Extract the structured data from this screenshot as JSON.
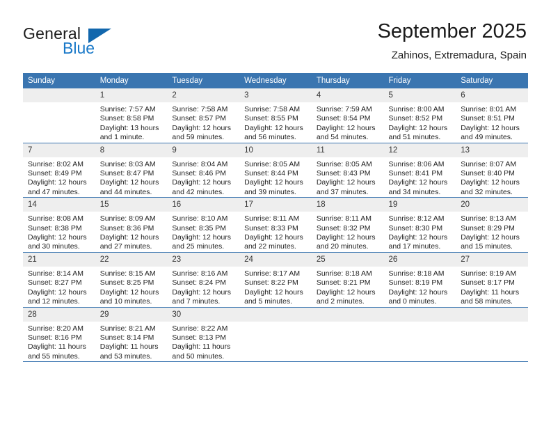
{
  "brand": {
    "name_part1": "General",
    "name_part2": "Blue"
  },
  "header": {
    "title": "September 2025",
    "subtitle": "Zahinos, Extremadura, Spain"
  },
  "colors": {
    "header_blue": "#3A75B0",
    "logo_blue": "#1878C8",
    "daynum_band": "#EEEEEE"
  },
  "weekday_headers": [
    "Sunday",
    "Monday",
    "Tuesday",
    "Wednesday",
    "Thursday",
    "Friday",
    "Saturday"
  ],
  "labels": {
    "sunrise_prefix": "Sunrise:",
    "sunset_prefix": "Sunset:",
    "daylight_prefix": "Daylight:"
  },
  "weeks": [
    [
      {
        "day": "",
        "sunrise": "",
        "sunset": "",
        "daylight1": "",
        "daylight2": ""
      },
      {
        "day": "1",
        "sunrise": "Sunrise: 7:57 AM",
        "sunset": "Sunset: 8:58 PM",
        "daylight1": "Daylight: 13 hours",
        "daylight2": "and 1 minute."
      },
      {
        "day": "2",
        "sunrise": "Sunrise: 7:58 AM",
        "sunset": "Sunset: 8:57 PM",
        "daylight1": "Daylight: 12 hours",
        "daylight2": "and 59 minutes."
      },
      {
        "day": "3",
        "sunrise": "Sunrise: 7:58 AM",
        "sunset": "Sunset: 8:55 PM",
        "daylight1": "Daylight: 12 hours",
        "daylight2": "and 56 minutes."
      },
      {
        "day": "4",
        "sunrise": "Sunrise: 7:59 AM",
        "sunset": "Sunset: 8:54 PM",
        "daylight1": "Daylight: 12 hours",
        "daylight2": "and 54 minutes."
      },
      {
        "day": "5",
        "sunrise": "Sunrise: 8:00 AM",
        "sunset": "Sunset: 8:52 PM",
        "daylight1": "Daylight: 12 hours",
        "daylight2": "and 51 minutes."
      },
      {
        "day": "6",
        "sunrise": "Sunrise: 8:01 AM",
        "sunset": "Sunset: 8:51 PM",
        "daylight1": "Daylight: 12 hours",
        "daylight2": "and 49 minutes."
      }
    ],
    [
      {
        "day": "7",
        "sunrise": "Sunrise: 8:02 AM",
        "sunset": "Sunset: 8:49 PM",
        "daylight1": "Daylight: 12 hours",
        "daylight2": "and 47 minutes."
      },
      {
        "day": "8",
        "sunrise": "Sunrise: 8:03 AM",
        "sunset": "Sunset: 8:47 PM",
        "daylight1": "Daylight: 12 hours",
        "daylight2": "and 44 minutes."
      },
      {
        "day": "9",
        "sunrise": "Sunrise: 8:04 AM",
        "sunset": "Sunset: 8:46 PM",
        "daylight1": "Daylight: 12 hours",
        "daylight2": "and 42 minutes."
      },
      {
        "day": "10",
        "sunrise": "Sunrise: 8:05 AM",
        "sunset": "Sunset: 8:44 PM",
        "daylight1": "Daylight: 12 hours",
        "daylight2": "and 39 minutes."
      },
      {
        "day": "11",
        "sunrise": "Sunrise: 8:05 AM",
        "sunset": "Sunset: 8:43 PM",
        "daylight1": "Daylight: 12 hours",
        "daylight2": "and 37 minutes."
      },
      {
        "day": "12",
        "sunrise": "Sunrise: 8:06 AM",
        "sunset": "Sunset: 8:41 PM",
        "daylight1": "Daylight: 12 hours",
        "daylight2": "and 34 minutes."
      },
      {
        "day": "13",
        "sunrise": "Sunrise: 8:07 AM",
        "sunset": "Sunset: 8:40 PM",
        "daylight1": "Daylight: 12 hours",
        "daylight2": "and 32 minutes."
      }
    ],
    [
      {
        "day": "14",
        "sunrise": "Sunrise: 8:08 AM",
        "sunset": "Sunset: 8:38 PM",
        "daylight1": "Daylight: 12 hours",
        "daylight2": "and 30 minutes."
      },
      {
        "day": "15",
        "sunrise": "Sunrise: 8:09 AM",
        "sunset": "Sunset: 8:36 PM",
        "daylight1": "Daylight: 12 hours",
        "daylight2": "and 27 minutes."
      },
      {
        "day": "16",
        "sunrise": "Sunrise: 8:10 AM",
        "sunset": "Sunset: 8:35 PM",
        "daylight1": "Daylight: 12 hours",
        "daylight2": "and 25 minutes."
      },
      {
        "day": "17",
        "sunrise": "Sunrise: 8:11 AM",
        "sunset": "Sunset: 8:33 PM",
        "daylight1": "Daylight: 12 hours",
        "daylight2": "and 22 minutes."
      },
      {
        "day": "18",
        "sunrise": "Sunrise: 8:11 AM",
        "sunset": "Sunset: 8:32 PM",
        "daylight1": "Daylight: 12 hours",
        "daylight2": "and 20 minutes."
      },
      {
        "day": "19",
        "sunrise": "Sunrise: 8:12 AM",
        "sunset": "Sunset: 8:30 PM",
        "daylight1": "Daylight: 12 hours",
        "daylight2": "and 17 minutes."
      },
      {
        "day": "20",
        "sunrise": "Sunrise: 8:13 AM",
        "sunset": "Sunset: 8:29 PM",
        "daylight1": "Daylight: 12 hours",
        "daylight2": "and 15 minutes."
      }
    ],
    [
      {
        "day": "21",
        "sunrise": "Sunrise: 8:14 AM",
        "sunset": "Sunset: 8:27 PM",
        "daylight1": "Daylight: 12 hours",
        "daylight2": "and 12 minutes."
      },
      {
        "day": "22",
        "sunrise": "Sunrise: 8:15 AM",
        "sunset": "Sunset: 8:25 PM",
        "daylight1": "Daylight: 12 hours",
        "daylight2": "and 10 minutes."
      },
      {
        "day": "23",
        "sunrise": "Sunrise: 8:16 AM",
        "sunset": "Sunset: 8:24 PM",
        "daylight1": "Daylight: 12 hours",
        "daylight2": "and 7 minutes."
      },
      {
        "day": "24",
        "sunrise": "Sunrise: 8:17 AM",
        "sunset": "Sunset: 8:22 PM",
        "daylight1": "Daylight: 12 hours",
        "daylight2": "and 5 minutes."
      },
      {
        "day": "25",
        "sunrise": "Sunrise: 8:18 AM",
        "sunset": "Sunset: 8:21 PM",
        "daylight1": "Daylight: 12 hours",
        "daylight2": "and 2 minutes."
      },
      {
        "day": "26",
        "sunrise": "Sunrise: 8:18 AM",
        "sunset": "Sunset: 8:19 PM",
        "daylight1": "Daylight: 12 hours",
        "daylight2": "and 0 minutes."
      },
      {
        "day": "27",
        "sunrise": "Sunrise: 8:19 AM",
        "sunset": "Sunset: 8:17 PM",
        "daylight1": "Daylight: 11 hours",
        "daylight2": "and 58 minutes."
      }
    ],
    [
      {
        "day": "28",
        "sunrise": "Sunrise: 8:20 AM",
        "sunset": "Sunset: 8:16 PM",
        "daylight1": "Daylight: 11 hours",
        "daylight2": "and 55 minutes."
      },
      {
        "day": "29",
        "sunrise": "Sunrise: 8:21 AM",
        "sunset": "Sunset: 8:14 PM",
        "daylight1": "Daylight: 11 hours",
        "daylight2": "and 53 minutes."
      },
      {
        "day": "30",
        "sunrise": "Sunrise: 8:22 AM",
        "sunset": "Sunset: 8:13 PM",
        "daylight1": "Daylight: 11 hours",
        "daylight2": "and 50 minutes."
      },
      {
        "day": "",
        "sunrise": "",
        "sunset": "",
        "daylight1": "",
        "daylight2": ""
      },
      {
        "day": "",
        "sunrise": "",
        "sunset": "",
        "daylight1": "",
        "daylight2": ""
      },
      {
        "day": "",
        "sunrise": "",
        "sunset": "",
        "daylight1": "",
        "daylight2": ""
      },
      {
        "day": "",
        "sunrise": "",
        "sunset": "",
        "daylight1": "",
        "daylight2": ""
      }
    ]
  ]
}
